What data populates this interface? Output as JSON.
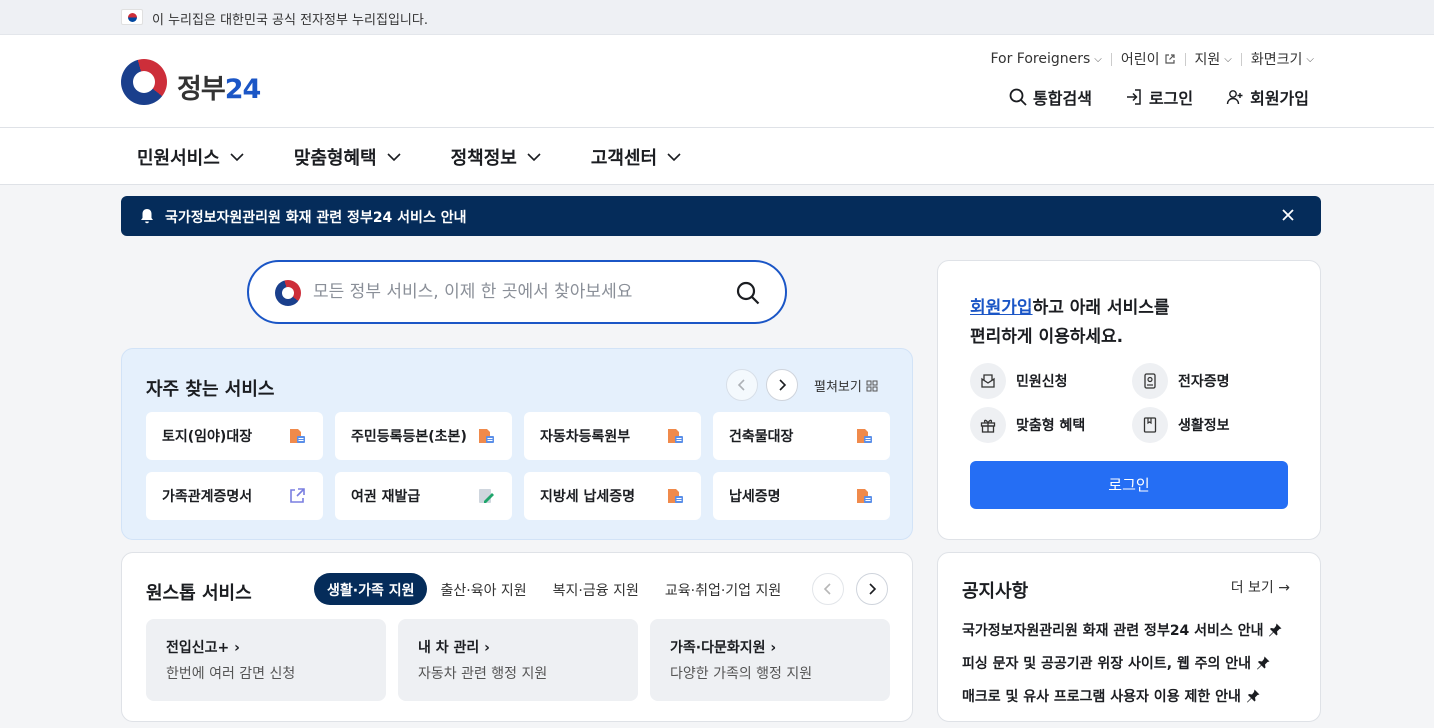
{
  "gov_banner": {
    "text": "이 누리집은 대한민국 공식 전자정부 누리집입니다."
  },
  "logo": {
    "word": "정부",
    "num": "24"
  },
  "util": {
    "foreigners": "For Foreigners",
    "kids": "어린이",
    "support": "지원",
    "screen_size": "화면크기"
  },
  "actions": {
    "search": "통합검색",
    "login": "로그인",
    "signup": "회원가입"
  },
  "gnb": [
    "민원서비스",
    "맞춤형혜택",
    "정책정보",
    "고객센터"
  ],
  "noticebar": {
    "text": "국가정보자원관리원 화재 관련 정부24 서비스 안내"
  },
  "search": {
    "placeholder": "모든 정부 서비스, 이제 한 곳에서 찾아보세요"
  },
  "frequent": {
    "title": "자주 찾는 서비스",
    "expand": "펼쳐보기",
    "items": [
      {
        "label": "토지(임야)대장",
        "icon": "document-icon"
      },
      {
        "label": "주민등록등본(초본)",
        "icon": "document-icon"
      },
      {
        "label": "자동차등록원부",
        "icon": "document-icon"
      },
      {
        "label": "건축물대장",
        "icon": "document-icon"
      },
      {
        "label": "가족관계증명서",
        "icon": "external-link-icon"
      },
      {
        "label": "여권 재발급",
        "icon": "edit-icon"
      },
      {
        "label": "지방세 납세증명",
        "icon": "document-icon"
      },
      {
        "label": "납세증명",
        "icon": "document-icon"
      }
    ]
  },
  "onestop": {
    "title": "원스톱 서비스",
    "tabs": [
      "생활·가족 지원",
      "출산·육아 지원",
      "복지·금융 지원",
      "교육·취업·기업 지원"
    ],
    "active_tab": 0,
    "cards": [
      {
        "title": "전입신고+",
        "sub": "한번에 여러 감면 신청"
      },
      {
        "title": "내 차 관리",
        "sub": "자동차 관련 행정 지원"
      },
      {
        "title": "가족·다문화지원",
        "sub": "다양한 가족의 행정 지원"
      }
    ]
  },
  "loginbox": {
    "link": "회원가입",
    "line1_rest": "하고 아래 서비스를",
    "line2": "편리하게 이용하세요.",
    "features": [
      "민원신청",
      "전자증명",
      "맞춤형 혜택",
      "생활정보"
    ],
    "button": "로그인"
  },
  "notices": {
    "title": "공지사항",
    "more": "더 보기",
    "items": [
      "국가정보자원관리원 화재 관련 정부24 서비스 안내",
      "피싱 문자 및 공공기관 위장 사이트, 웹 주의 안내",
      "매크로 및 유사 프로그램 사용자 이용 제한 안내"
    ]
  },
  "colors": {
    "navy": "#052c5a",
    "primary": "#256ef4",
    "brand_blue": "#1b56c6",
    "light_blue_bg": "#e5f0fc"
  }
}
